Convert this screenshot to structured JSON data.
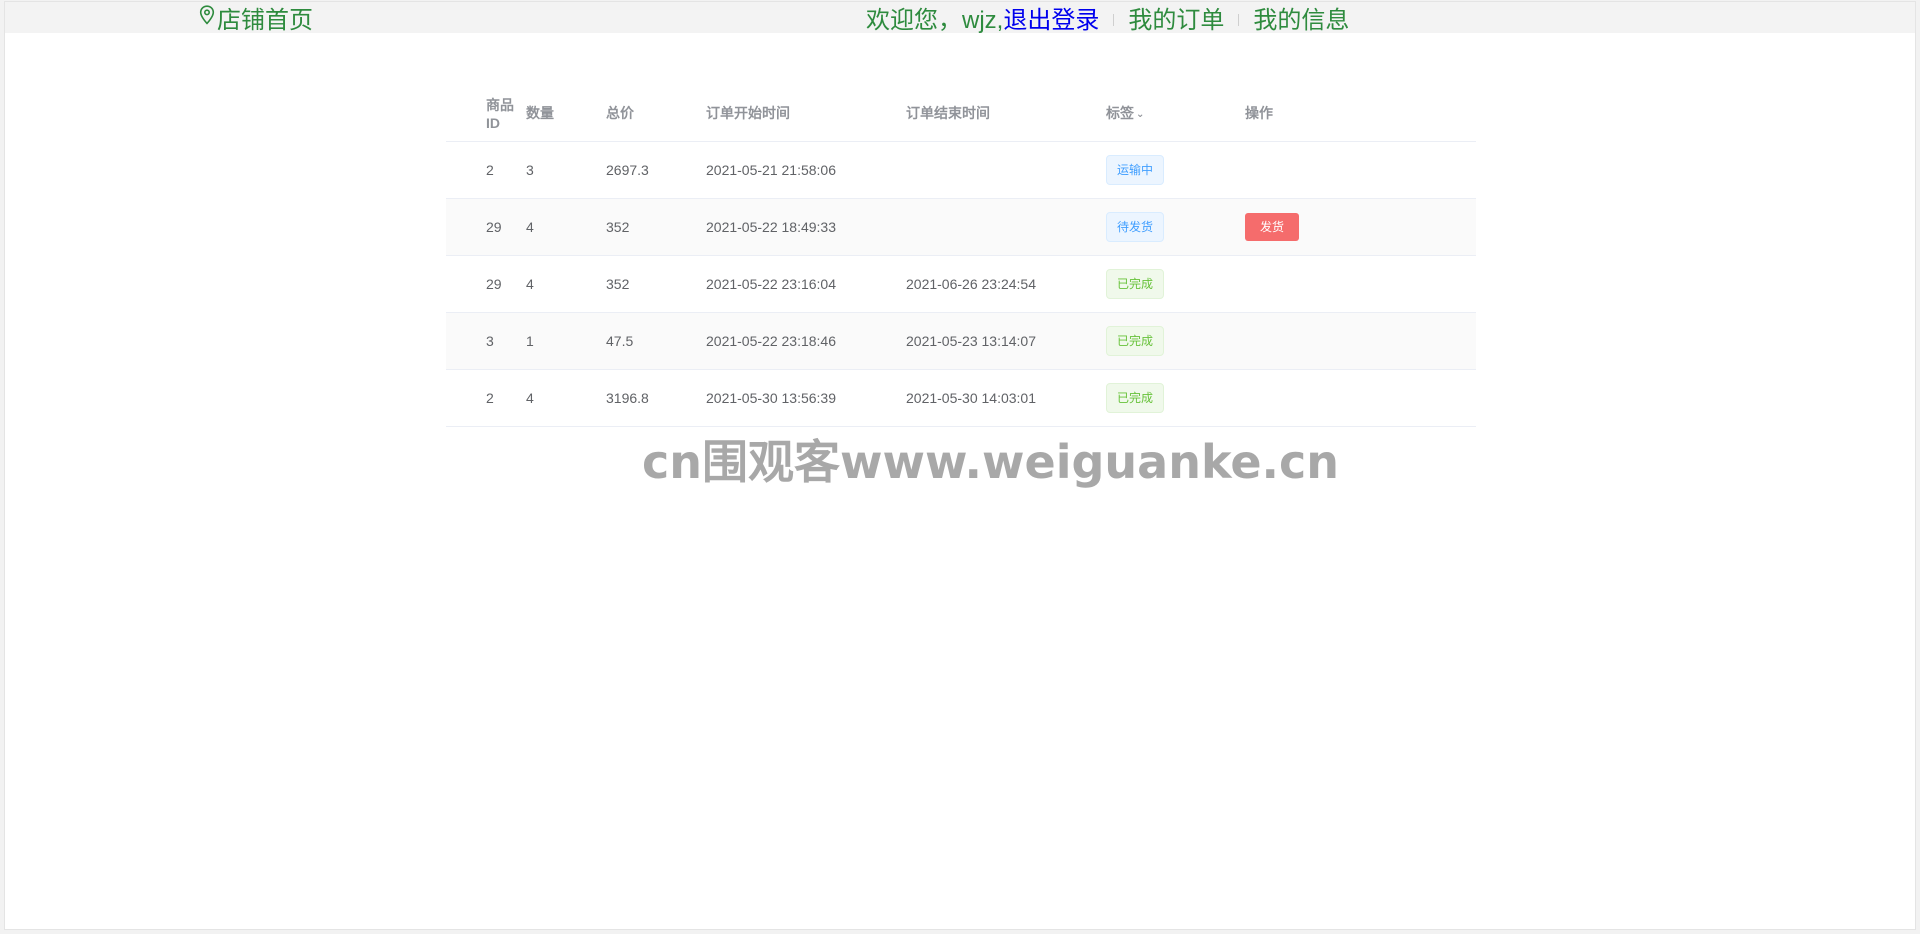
{
  "header": {
    "home_icon": "location-pin-icon",
    "home_label": "店铺首页",
    "welcome_text": "欢迎您，wjz,",
    "logout_label": "退出登录",
    "my_orders_label": "我的订单",
    "my_info_label": "我的信息",
    "link_color": "#2e8b3e",
    "logout_color": "#0000ee"
  },
  "table": {
    "columns": [
      "商品ID",
      "数量",
      "总价",
      "订单开始时间",
      "订单结束时间",
      "标签",
      "操作"
    ],
    "tag_filter_icon": "chevron-down-icon",
    "rows": [
      {
        "product_id": "2",
        "quantity": "3",
        "total": "2697.3",
        "start_time": "2021-05-21 21:58:06",
        "end_time": "",
        "tag": "运输中",
        "tag_color": "#409eff",
        "action": ""
      },
      {
        "product_id": "29",
        "quantity": "4",
        "total": "352",
        "start_time": "2021-05-22 18:49:33",
        "end_time": "",
        "tag": "待发货",
        "tag_color": "#409eff",
        "action": "发货"
      },
      {
        "product_id": "29",
        "quantity": "4",
        "total": "352",
        "start_time": "2021-05-22 23:16:04",
        "end_time": "2021-06-26 23:24:54",
        "tag": "已完成",
        "tag_color": "#67c23a",
        "action": ""
      },
      {
        "product_id": "3",
        "quantity": "1",
        "total": "47.5",
        "start_time": "2021-05-22 23:18:46",
        "end_time": "2021-05-23 13:14:07",
        "tag": "已完成",
        "tag_color": "#67c23a",
        "action": ""
      },
      {
        "product_id": "2",
        "quantity": "4",
        "total": "3196.8",
        "start_time": "2021-05-30 13:56:39",
        "end_time": "2021-05-30 14:03:01",
        "tag": "已完成",
        "tag_color": "#67c23a",
        "action": ""
      }
    ],
    "ship_button_color": "#f56c6c"
  },
  "watermark": {
    "text": "cn围观客www.weiguanke.cn"
  }
}
